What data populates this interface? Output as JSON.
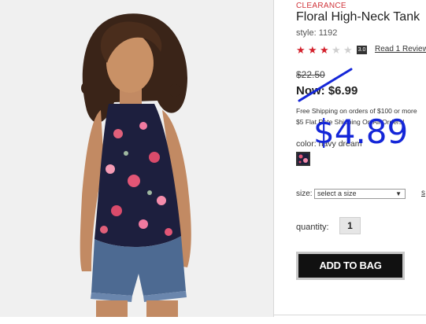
{
  "product": {
    "badge": "CLEARANCE",
    "title": "Floral High-Neck Tank",
    "style_number": "style: 1192",
    "rating_value": 3,
    "rating_max": 5,
    "rating_badge": "3.0",
    "review_link": "Read 1 Review",
    "was_price": "$22.50",
    "now_price": "Now: $6.99",
    "handwritten_price": "$4.89",
    "shipping_line_1": "Free Shipping on orders of $100 or more",
    "shipping_line_2": "$5 Flat Rate Shipping On All Orders!",
    "color_label": "color: navy dream",
    "size_label": "size:",
    "size_placeholder": "select a size",
    "size_chart_link": "s",
    "quantity_label": "quantity:",
    "quantity_value": "1",
    "add_to_bag": "ADD TO BAG"
  },
  "colors": {
    "clearance": "#d0343a",
    "star_on": "#d3202b",
    "star_off": "#cfcfcf",
    "annotation": "#1426d8",
    "button_bg": "#111111"
  },
  "icons": {
    "star": "star-icon",
    "caret": "chevron-down-icon"
  }
}
